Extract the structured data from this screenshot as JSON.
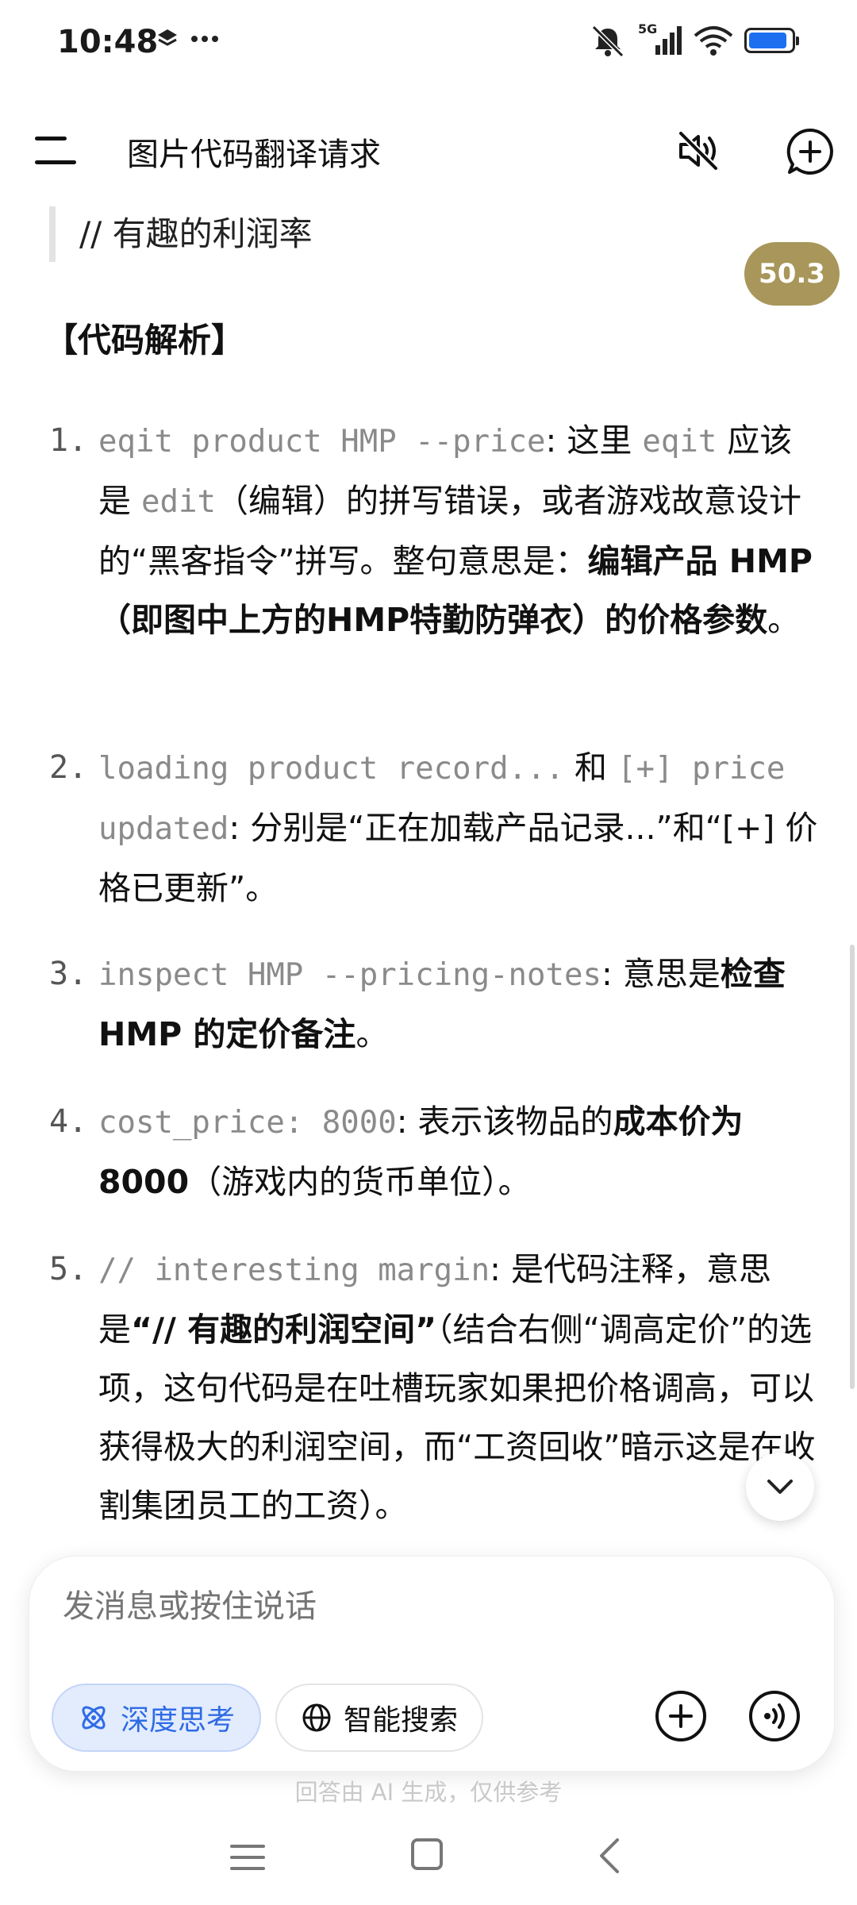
{
  "status_bar": {
    "time": "10:48",
    "left_icons": [
      "layers-icon",
      "more-dots-icon"
    ],
    "right_icons": [
      "mute-bell-icon",
      "5g-signal-icon",
      "wifi-icon",
      "battery-icon"
    ],
    "network_label": "5G",
    "battery_level": 0.9
  },
  "header": {
    "title": "图片代码翻译请求",
    "icons": [
      "menu-icon",
      "speaker-muted-icon",
      "new-chat-icon"
    ]
  },
  "message": {
    "quote_text": "// 有趣的利润率",
    "score_badge": "50.3",
    "section_title": "【代码解析】",
    "items": [
      {
        "number": "1.",
        "code": "eqit product HMP --price",
        "t1": ": 这里 ",
        "code2": "eqit",
        "t2": " 应该是 ",
        "code3": "edit",
        "t3": "（编辑）的拼写错误，或者游戏故意设计的“黑客指令”拼写。整句意思是：",
        "bold": "编辑产品 HMP（即图中上方的HMP特勤防弹衣）的价格参数",
        "t4": "。"
      },
      {
        "number": "2.",
        "code": "loading product record...",
        "t1": " 和 ",
        "code2": "[+] price updated",
        "t2": ": 分别是“正在加载产品记录...”和“[+] 价格已更新”。"
      },
      {
        "number": "3.",
        "code": "inspect HMP --pricing-notes",
        "t1": ": 意思是",
        "bold": "检查 HMP 的定价备注",
        "t2": "。"
      },
      {
        "number": "4.",
        "code": "cost_price: 8000",
        "t1": ": 表示该物品的",
        "bold": "成本价为 8000",
        "t2": "（游戏内的货币单位）。"
      },
      {
        "number": "5.",
        "code": "// interesting margin",
        "t1": ": 是代码注释，意思是",
        "bold": "“// 有趣的利润空间”",
        "t2": "（结合右侧“调高定价”的选项，这句代码是在吐槽玩家如果把价格调高，可以获得极大的利润空间，而“工资回收”暗示这是在收割集团员工的工资）。"
      }
    ]
  },
  "composer": {
    "placeholder": "发消息或按住说话",
    "deep_think_label": "深度思考",
    "smart_search_label": "智能搜索",
    "deep_think_active": true,
    "icons": [
      "atom-icon",
      "globe-icon",
      "plus-circle-icon",
      "voice-call-icon"
    ]
  },
  "disclaimer": "回答由 AI 生成，仅供参考",
  "nav_bar": {
    "icons": [
      "recent-apps-icon",
      "home-icon",
      "back-icon"
    ]
  },
  "colors": {
    "accent": "#2f6be6",
    "badge": "#a8965a",
    "code_text": "#8a8a8a",
    "battery": "#1e6ff0"
  }
}
